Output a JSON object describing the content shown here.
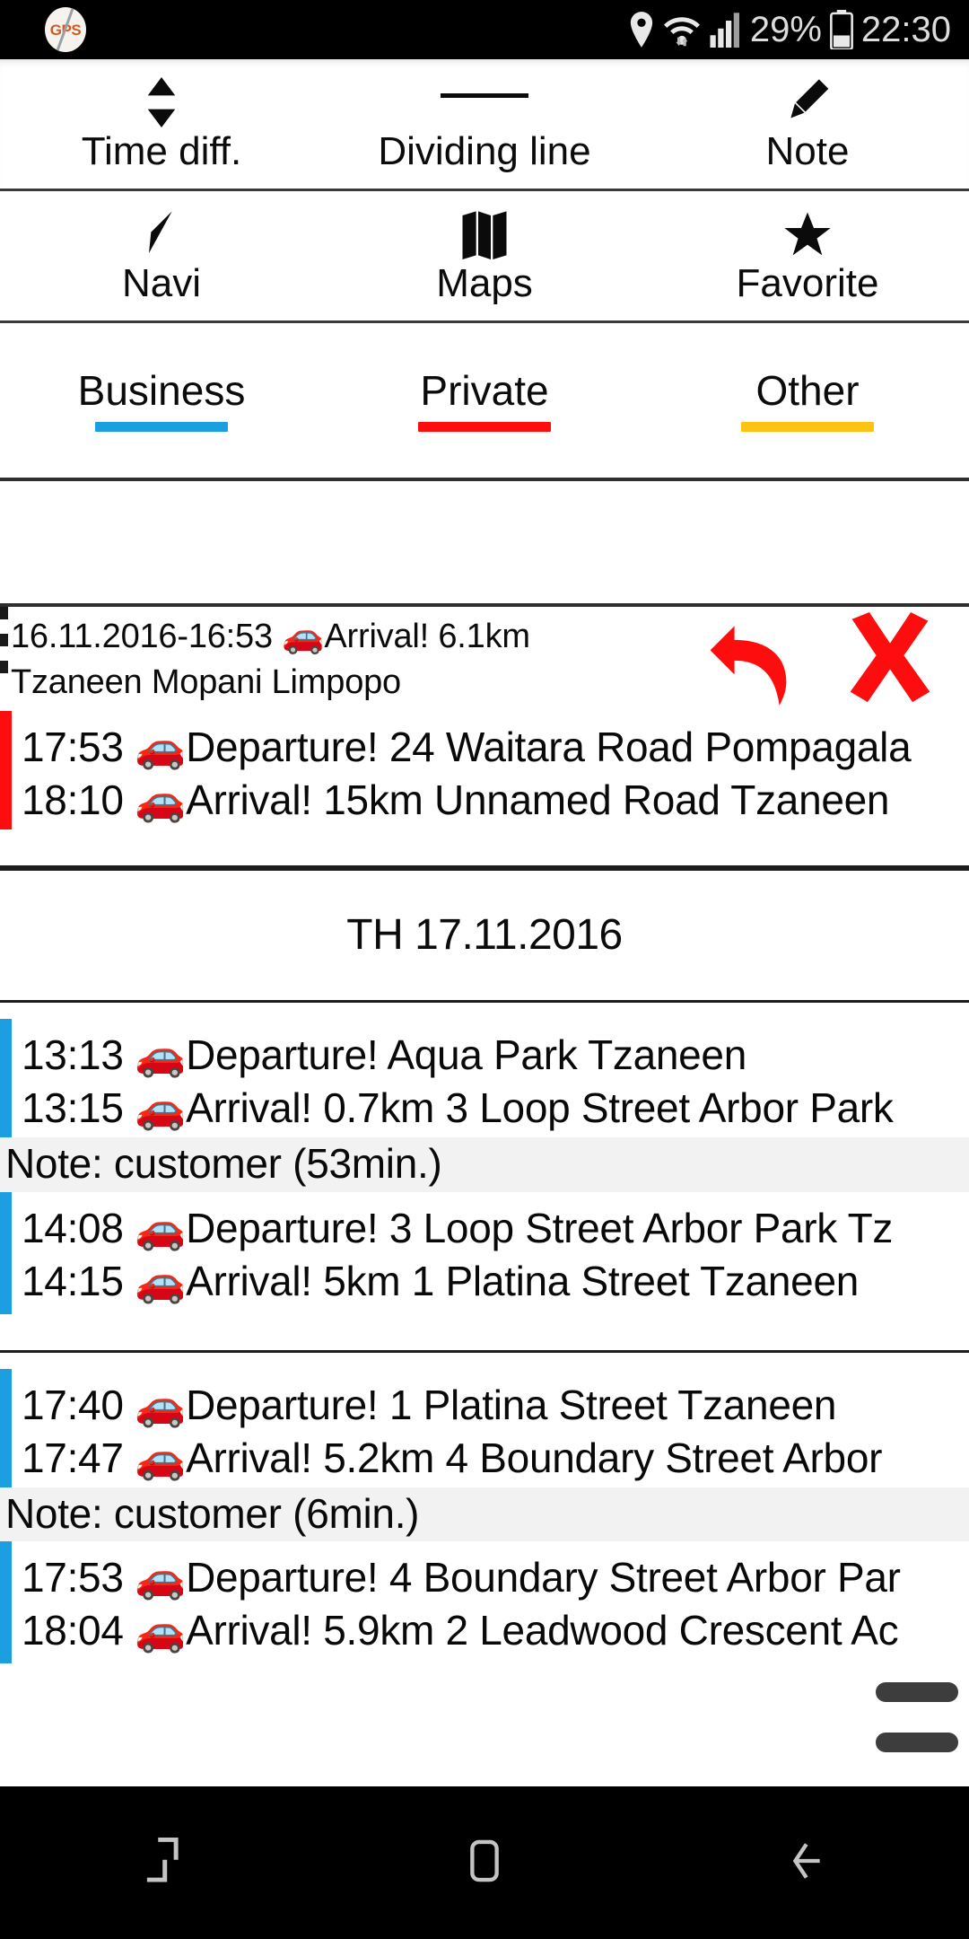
{
  "status_bar": {
    "gps_badge_label": "GPS",
    "battery_percent": "29%",
    "clock": "22:30",
    "icons": [
      "location-pin-icon",
      "wifi-icon",
      "cellular-signal-icon",
      "battery-icon"
    ]
  },
  "toolbar": {
    "row1": [
      {
        "label": "Time diff.",
        "icon": "up-down-arrows-icon",
        "name": "time-diff"
      },
      {
        "label": "Dividing line",
        "icon": "horizontal-line-icon",
        "name": "dividing-line"
      },
      {
        "label": "Note",
        "icon": "pencil-icon",
        "name": "note"
      }
    ],
    "row2": [
      {
        "label": "Navi",
        "icon": "navigation-arrow-icon",
        "name": "navi"
      },
      {
        "label": "Maps",
        "icon": "folded-map-icon",
        "name": "maps"
      },
      {
        "label": "Favorite",
        "icon": "star-icon",
        "name": "favorite"
      }
    ]
  },
  "categories": [
    {
      "label": "Business",
      "color": "#1b9fe0"
    },
    {
      "label": "Private",
      "color": "#fd0d0d"
    },
    {
      "label": "Other",
      "color": "#fdc313"
    }
  ],
  "last_entry": {
    "line1": "16.11.2016-16:53 🚗Arrival! 6.1km",
    "line2": "Tzaneen Mopani Limpopo",
    "undo_label": "undo",
    "delete_label": "delete",
    "action_color": "#fd0d0d"
  },
  "date_separator": {
    "text": "TH 17.11.2016"
  },
  "trips": [
    {
      "category": "Private",
      "color": "#fd0d0d",
      "lines": [
        "17:53 🚗Departure! 24 Waitara Road Pompagala",
        "18:10 🚗Arrival! 15km Unnamed Road Tzaneen"
      ],
      "note": null
    },
    {
      "category": "Business",
      "color": "#1b9fe0",
      "lines": [
        "13:13 🚗Departure! Aqua Park Tzaneen",
        "13:15 🚗Arrival! 0.7km 3 Loop Street Arbor Park"
      ],
      "note": "Note:  customer (53min.)"
    },
    {
      "category": "Business",
      "color": "#1b9fe0",
      "lines": [
        "14:08 🚗Departure! 3 Loop Street Arbor Park Tz",
        "14:15 🚗Arrival! 5km 1 Platina Street Tzaneen"
      ],
      "note": null
    },
    {
      "category": "Business",
      "color": "#1b9fe0",
      "lines": [
        "17:40 🚗Departure! 1 Platina Street Tzaneen",
        "17:47 🚗Arrival! 5.2km 4 Boundary Street Arbor"
      ],
      "note": "Note:  customer (6min.)"
    },
    {
      "category": "Business",
      "color": "#1b9fe0",
      "lines": [
        "17:53 🚗Departure! 4 Boundary Street Arbor Par",
        "18:04 🚗Arrival! 5.9km 2 Leadwood Crescent Ac"
      ],
      "note": null
    }
  ],
  "nav_bar": {
    "items": [
      {
        "name": "recents-button",
        "icon": "recents-icon"
      },
      {
        "name": "home-button",
        "icon": "home-square-icon"
      },
      {
        "name": "back-button",
        "icon": "back-arrow-icon"
      }
    ]
  }
}
